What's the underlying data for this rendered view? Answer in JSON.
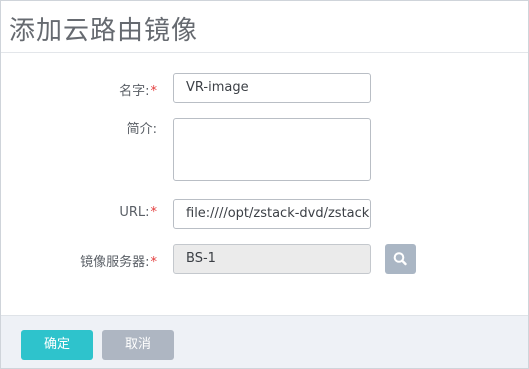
{
  "dialog": {
    "title": "添加云路由镜像"
  },
  "form": {
    "name": {
      "label": "名字:",
      "required_mark": "*",
      "value": "VR-image"
    },
    "description": {
      "label": "简介:",
      "value": ""
    },
    "url": {
      "label": "URL:",
      "required_mark": "*",
      "value": "file:////opt/zstack-dvd/zstack-vyos"
    },
    "backup_storage": {
      "label": "镜像服务器:",
      "required_mark": "*",
      "value": "BS-1"
    }
  },
  "footer": {
    "ok_label": "确定",
    "cancel_label": "取消"
  },
  "icons": {
    "search": "search-icon"
  },
  "colors": {
    "primary": "#2ec3cc",
    "cancel": "#aeb6c2",
    "required": "#e23b3b",
    "search_button": "#aab6c4"
  }
}
